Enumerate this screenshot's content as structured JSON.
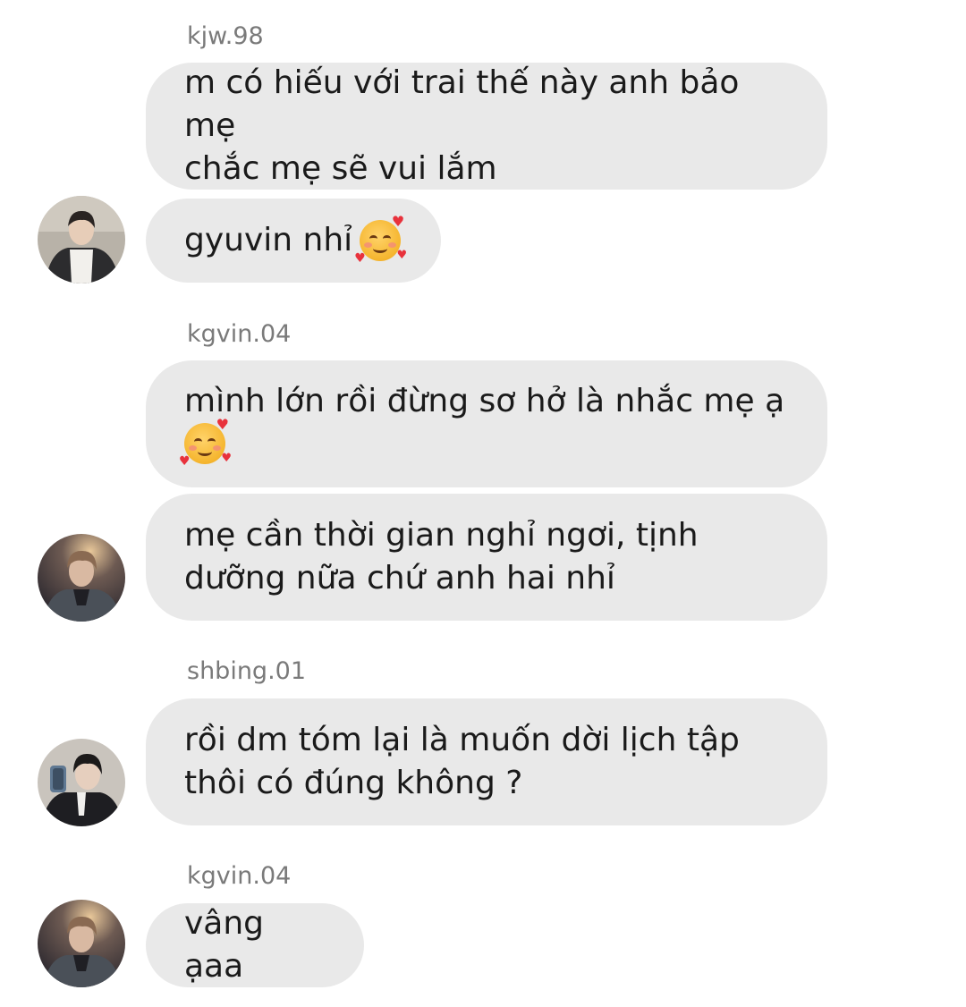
{
  "messages": [
    {
      "username": "kjw.98",
      "bubbles": [
        "m có hiếu với trai thế này anh bảo mẹ\nchắc mẹ sẽ vui lắm",
        "gyuvin nhỉ"
      ],
      "emoji": "smiling-face-with-hearts"
    },
    {
      "username": "kgvin.04",
      "bubbles": [
        "mình lớn rồi đừng sơ hở là nhắc mẹ ạ",
        "mẹ cần thời gian nghỉ ngơi, tịnh\ndưỡng nữa chứ anh hai nhỉ"
      ],
      "emoji": "smiling-face-with-hearts"
    },
    {
      "username": "shbing.01",
      "bubbles": [
        "rồi dm tóm lại là muốn dời lịch tập\nthôi có đúng không ?"
      ]
    },
    {
      "username": "kgvin.04",
      "bubbles": [
        "vâng ạaa"
      ]
    }
  ],
  "colors": {
    "background": "#ffffff",
    "bubble": "#e9e9e9",
    "text": "#1a1a1a",
    "username": "#7a7a7a"
  }
}
